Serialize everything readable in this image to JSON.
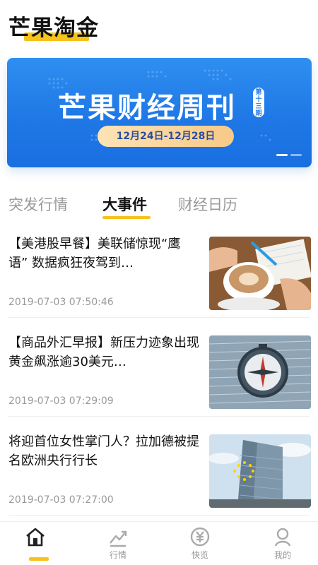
{
  "app": {
    "title": "芒果淘金"
  },
  "banner": {
    "heading": "芒果财经周刊",
    "issue": "第十三期",
    "date_range": "12月24日-12月28日"
  },
  "tabs": [
    {
      "label": "突发行情",
      "active": false
    },
    {
      "label": "大事件",
      "active": true
    },
    {
      "label": "财经日历",
      "active": false
    }
  ],
  "news": [
    {
      "title": "【美港股早餐】美联储惊现“鹰语” 数据疯狂夜驾到…",
      "time": "2019-07-03 07:50:46",
      "thumb": "coffee-notebook"
    },
    {
      "title": "【商品外汇早报】新压力迹象出现黄金飙涨逾30美元…",
      "time": "2019-07-03 07:29:09",
      "thumb": "compass-on-newspaper"
    },
    {
      "title": "将迎首位女性掌门人？拉加德被提名欧洲央行行长",
      "time": "2019-07-03 07:27:00",
      "thumb": "ecb-tower"
    }
  ],
  "tabbar": [
    {
      "label": "",
      "icon": "home-icon",
      "active": true
    },
    {
      "label": "行情",
      "icon": "trend-chart-icon",
      "active": false
    },
    {
      "label": "快览",
      "icon": "yuan-coin-icon",
      "active": false
    },
    {
      "label": "我的",
      "icon": "user-icon",
      "active": false
    }
  ],
  "colors": {
    "accent": "#f6c21c",
    "banner_blue": "#1f78e6",
    "muted_text": "#999999"
  }
}
